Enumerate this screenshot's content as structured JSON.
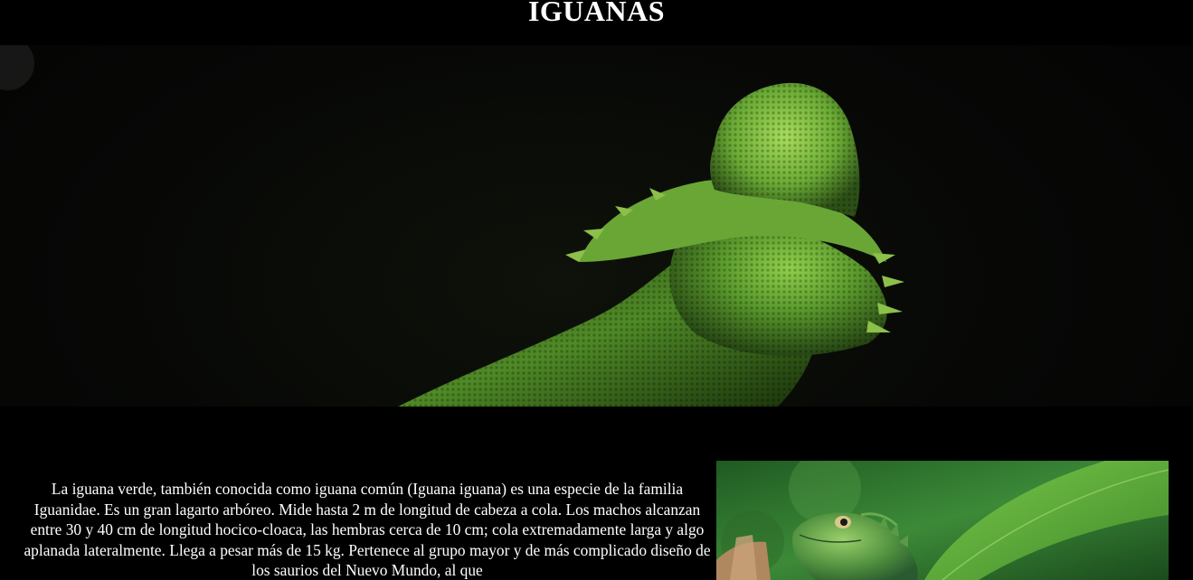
{
  "header": {
    "title": "IGUANAS"
  },
  "hero": {
    "icon": "iguana-photo",
    "accent_color": "#5a9a2c"
  },
  "article": {
    "paragraph": "La iguana verde, también conocida como iguana común (Iguana iguana) es una especie de la familia Iguanidae. Es un gran lagarto arbóreo. Mide hasta 2 m de longitud de cabeza a cola. Los machos alcanzan entre 30 y 40 cm de longitud hocico-cloaca, las hembras cerca de 10 cm; cola extremadamente larga y algo aplanada lateralmente. Llega a pesar más de 15 kg. Pertenece al grupo mayor y de más complicado diseño de los saurios del Nuevo Mundo, al que"
  },
  "side_image": {
    "icon": "green-lizard-photo",
    "accent_color": "#3d8a3a"
  }
}
